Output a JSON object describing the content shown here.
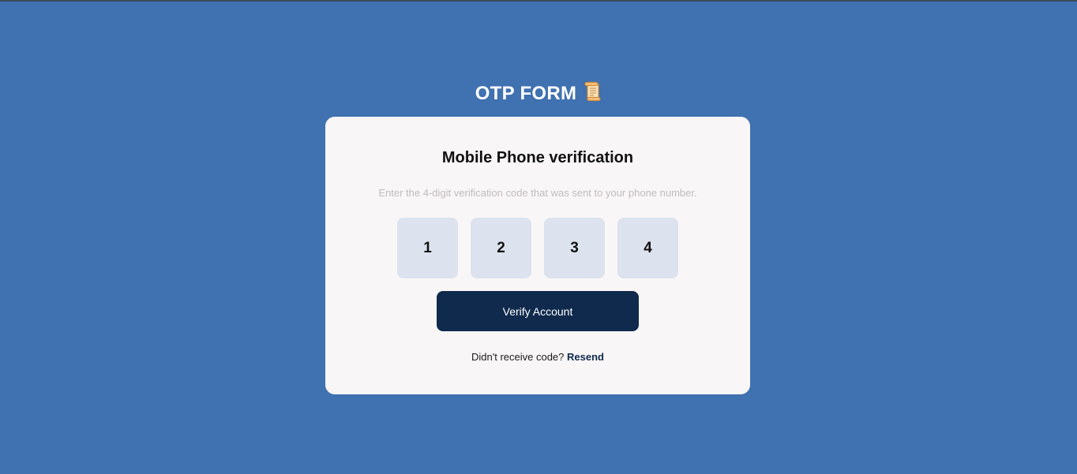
{
  "page": {
    "title": "OTP FORM",
    "title_icon": "scroll-icon"
  },
  "card": {
    "title": "Mobile Phone verification",
    "description": "Enter the 4-digit verification code that was sent to your phone number.",
    "otp_digits": [
      "1",
      "2",
      "3",
      "4"
    ],
    "verify_label": "Verify Account",
    "resend_prompt": "Didn't receive code?",
    "resend_label": "Resend"
  },
  "colors": {
    "background": "#4071b0",
    "card": "#f9f6f7",
    "otp_box": "#dce2ee",
    "button": "#0f2a4d"
  }
}
